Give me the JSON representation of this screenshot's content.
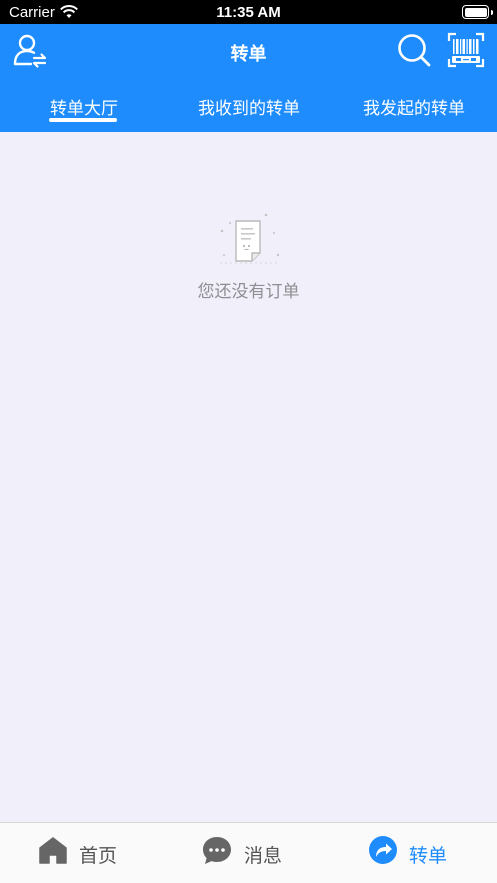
{
  "status_bar": {
    "carrier": "Carrier",
    "time": "11:35 AM"
  },
  "header": {
    "title": "转单",
    "left_icon": "user-transfer-icon",
    "right_icons": [
      "search-icon",
      "scan-barcode-icon"
    ],
    "background_color": "#1e8cfc"
  },
  "tabs": {
    "items": [
      {
        "label": "转单大厅",
        "active": true
      },
      {
        "label": "我收到的转单",
        "active": false
      },
      {
        "label": "我发起的转单",
        "active": false
      }
    ]
  },
  "empty_state": {
    "icon": "empty-document-icon",
    "message": "您还没有订单"
  },
  "tabbar": {
    "items": [
      {
        "label": "首页",
        "icon": "home-icon",
        "active": false
      },
      {
        "label": "消息",
        "icon": "message-bubble-icon",
        "active": false
      },
      {
        "label": "转单",
        "icon": "share-arrow-icon",
        "active": true
      }
    ],
    "active_color": "#1e8cfc",
    "inactive_color": "#555555"
  }
}
